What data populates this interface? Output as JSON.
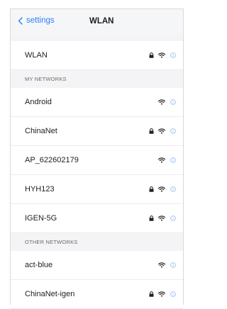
{
  "header": {
    "back_label": "settings",
    "title": "WLAN"
  },
  "wlan_toggle_row": {
    "label": "WLAN",
    "locked": true
  },
  "my_networks": {
    "header": "MY NETWORKS",
    "items": [
      {
        "name": "Android",
        "locked": false
      },
      {
        "name": "ChinaNet",
        "locked": true
      },
      {
        "name": "AP_622602179",
        "locked": false
      },
      {
        "name": "HYH123",
        "locked": true
      },
      {
        "name": "IGEN-5G",
        "locked": true
      }
    ]
  },
  "other_networks": {
    "header": "OTHER  NETWORKS",
    "items": [
      {
        "name": "act-blue",
        "locked": false
      },
      {
        "name": "ChinaNet-igen",
        "locked": true
      }
    ]
  },
  "colors": {
    "accent": "#2f7df6",
    "info_icon": "#8fb4f5",
    "section_bg": "#f4f4f6"
  }
}
